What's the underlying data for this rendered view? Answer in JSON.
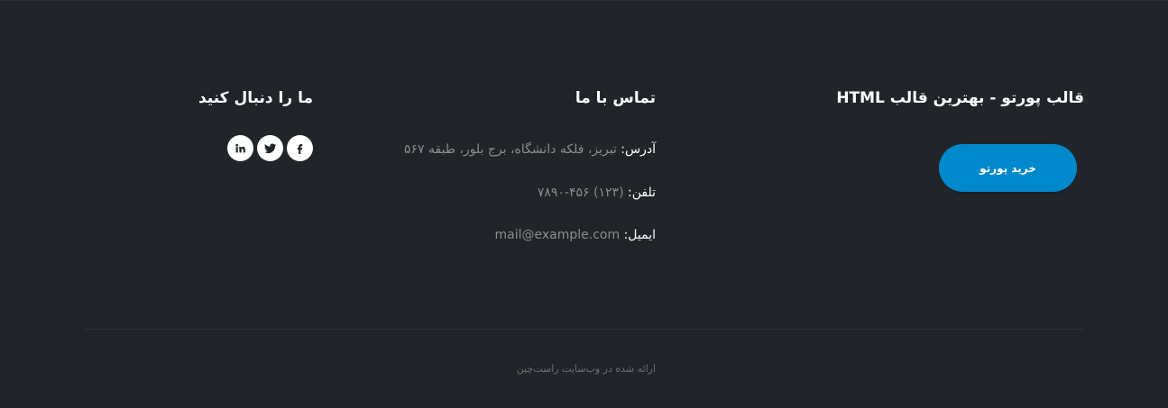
{
  "columns": {
    "porto": {
      "title": "قالب پورتو - بهترین قالب HTML",
      "buy_button": "خرید پورتو"
    },
    "contact": {
      "title": "تماس با ما",
      "address_label": "آدرس:",
      "address_value": "تبریز، فلکه دانشگاه، برج بلور، طبقه ۵۶۷",
      "phone_label": "تلفن:",
      "phone_value": "(۱۲۳) ۴۵۶-۷۸۹۰",
      "email_label": "ایمیل:",
      "email_value": "mail@example.com"
    },
    "follow": {
      "title": "ما را دنبال کنید",
      "icons": [
        "facebook-icon",
        "twitter-icon",
        "linkedin-icon"
      ]
    }
  },
  "copyright": "ارائه شده در وب‌سایت راست‌چین",
  "colors": {
    "background": "#212529",
    "accent": "#0088cc",
    "muted_text": "#8a8d90"
  }
}
